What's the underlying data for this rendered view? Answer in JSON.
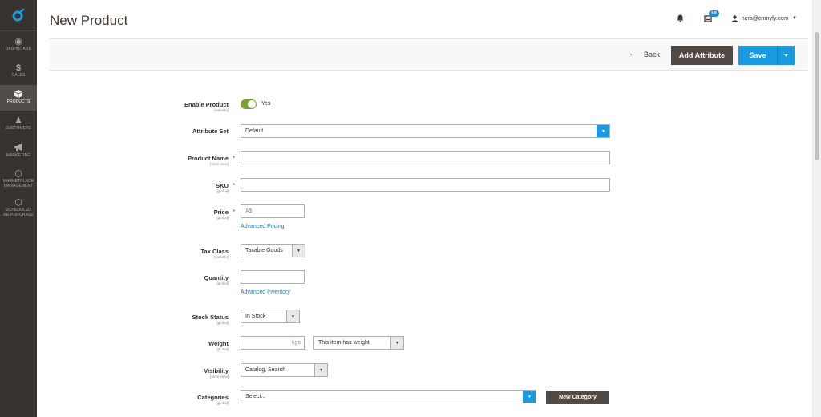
{
  "header": {
    "title": "New Product",
    "cart_badge": "1/0",
    "user_email": "hera@omnyfy.com"
  },
  "sidebar": {
    "items": [
      {
        "label": "DASHBOARD",
        "icon": "dashboard-icon",
        "glyph": "◉"
      },
      {
        "label": "SALES",
        "icon": "dollar-icon",
        "glyph": "$"
      },
      {
        "label": "PRODUCTS",
        "icon": "cube-icon",
        "glyph": "◆",
        "active": true
      },
      {
        "label": "CUSTOMERS",
        "icon": "person-icon",
        "glyph": "♟"
      },
      {
        "label": "MARKETING",
        "icon": "megaphone-icon",
        "glyph": "◀"
      },
      {
        "label": "MARKETPLACE",
        "label2": "MANAGEMENT",
        "icon": "hexagon-icon",
        "glyph": "⬡"
      },
      {
        "label": "SCHEDULED",
        "label2": "RE-PURCHASE",
        "icon": "hexagon-icon",
        "glyph": "⬡"
      }
    ]
  },
  "actionbar": {
    "back_label": "Back",
    "add_attribute_label": "Add Attribute",
    "save_label": "Save"
  },
  "form": {
    "enable_product": {
      "label": "Enable Product",
      "scope": "[website]",
      "value": "Yes"
    },
    "attribute_set": {
      "label": "Attribute Set",
      "value": "Default"
    },
    "product_name": {
      "label": "Product Name",
      "scope": "[store view]",
      "value": ""
    },
    "sku": {
      "label": "SKU",
      "scope": "[global]",
      "value": ""
    },
    "price": {
      "label": "Price",
      "scope": "[global]",
      "prefix": "A$",
      "link": "Advanced Pricing"
    },
    "tax_class": {
      "label": "Tax Class",
      "scope": "[website]",
      "value": "Taxable Goods"
    },
    "quantity": {
      "label": "Quantity",
      "scope": "[global]",
      "value": "",
      "link": "Advanced Inventory"
    },
    "stock_status": {
      "label": "Stock Status",
      "scope": "[global]",
      "value": "In Stock"
    },
    "weight": {
      "label": "Weight",
      "scope": "[global]",
      "unit": "kgs",
      "has_weight": "This item has weight"
    },
    "visibility": {
      "label": "Visibility",
      "scope": "[store view]",
      "value": "Catalog, Search"
    },
    "categories": {
      "label": "Categories",
      "scope": "[global]",
      "placeholder": "Select...",
      "new_label": "New Category"
    }
  },
  "colors": {
    "sidebar_bg": "#373330",
    "primary_blue": "#1a9ae1",
    "dark_button": "#514943",
    "toggle_on": "#79a22e",
    "link": "#1979c3"
  }
}
